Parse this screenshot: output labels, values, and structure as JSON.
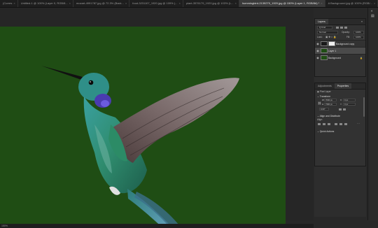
{
  "tabs": [
    {
      "label": "(Corres",
      "active": false
    },
    {
      "label": "Untitled-1 @ 100% (Layer 0, RGB/8...",
      "active": false
    },
    {
      "label": "mozart-4991787.jpg @ 72.3% (Back...",
      "active": false
    },
    {
      "label": "food-3231107_1920.jpg @ 109% (...",
      "active": false
    },
    {
      "label": "plant-3576179_1920.jpg @ 103% (L...",
      "active": false
    },
    {
      "label": "hummingbird-2139279_1920.jpg @ 150% (Layer 1, RGB/8#) *",
      "active": true
    },
    {
      "label": "A Background.jpg @ 100% (RGB/...",
      "active": false
    }
  ],
  "status": {
    "zoom": "150%"
  },
  "layers_panel": {
    "tab": "Layers",
    "kind": "Q Kind",
    "blend": "Normal",
    "opacity_label": "Opacity:",
    "opacity": "100%",
    "lock_label": "Lock:",
    "fill_label": "Fill:",
    "fill": "100%",
    "layers": [
      {
        "name": "Background copy",
        "active": false
      },
      {
        "name": "Layer 1",
        "active": true
      },
      {
        "name": "Background",
        "active": false
      }
    ]
  },
  "properties_panel": {
    "tabs": [
      "Adjustments",
      "Properties"
    ],
    "kind": "Pixel Layer",
    "transform_title": "Transform",
    "w_label": "W",
    "w": "7630 px",
    "h_label": "H",
    "h": "7360 px",
    "x_label": "X",
    "x": "0 px",
    "y_label": "Y",
    "y": "0 px",
    "angle": "0.00°",
    "align_title": "Align and Distribute",
    "align_sub": "Align:",
    "quick_title": "Quick Actions"
  },
  "colors": {
    "canvas_bg": "#1f4d14",
    "ui_dark": "#282828",
    "panel": "#323232",
    "active_tab": "#3a3a3a"
  },
  "icons": [
    "eye-icon",
    "lock-icon",
    "link-icon",
    "chevron-icon",
    "menu-icon",
    "close-icon"
  ]
}
